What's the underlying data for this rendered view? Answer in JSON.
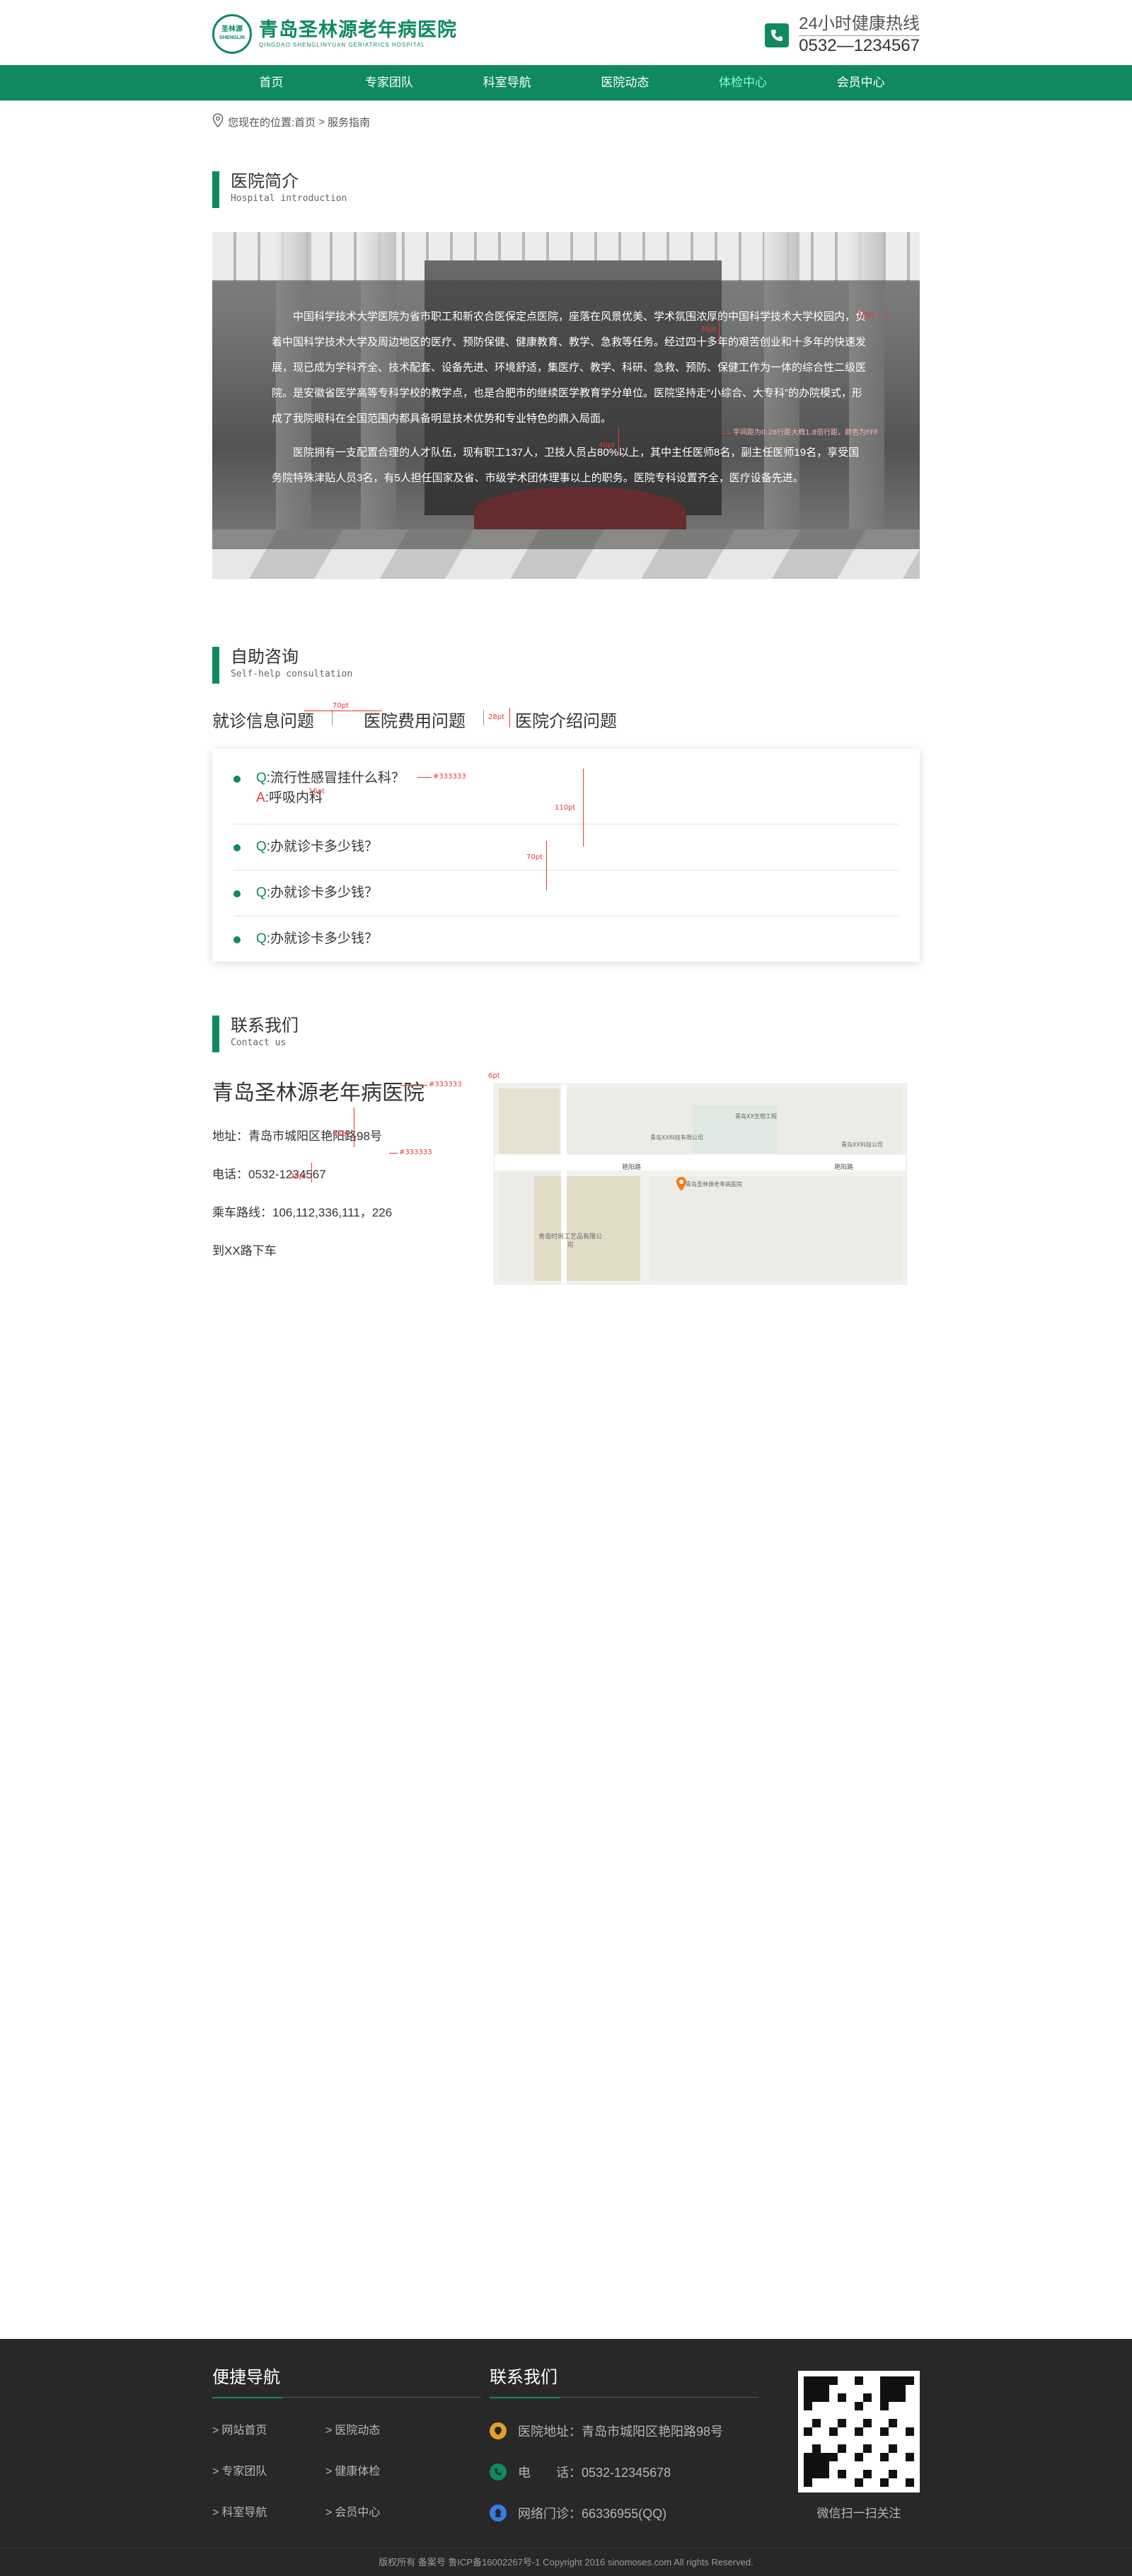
{
  "header": {
    "logo_mark_line1": "圣林源",
    "logo_mark_line2": "SHENGLIN",
    "logo_cn": "青岛圣林源老年病医院",
    "logo_en": "QINGDAO SHENGLINYUAN GERIATRICS HOSPITAL",
    "hotline_title": "24小时健康热线",
    "hotline_number": "0532—1234567"
  },
  "nav": {
    "items": [
      "首页",
      "专家团队",
      "科室导航",
      "医院动态",
      "体检中心",
      "会员中心"
    ],
    "active_index": 4
  },
  "breadcrumb": {
    "prefix": "您现在的位置:",
    "home": "首页",
    "separator": ">",
    "current": "服务指南"
  },
  "intro": {
    "title_cn": "医院简介",
    "title_en": "Hospital introduction",
    "paragraph1": "中国科学技术大学医院为省市职工和新农合医保定点医院，座落在风景优美、学术氛围浓厚的中国科学技术大学校园内，负着中国科学技术大学及周边地区的医疗、预防保健、健康教育、教学、急救等任务。经过四十多年的艰苦创业和十多年的快速发展，现已成为学科齐全、技术配套、设备先进、环境舒适，集医疗、教学、科研、急救、预防、保健工作为一体的综合性二级医院。是安徽省医学高等专科学校的教学点，也是合肥市的继续医学教育学分单位。医院坚持走“小综合、大专科”的办院模式，形成了我院眼科在全国范围内都具备明显技术优势和专业特色的鼎入局面。",
    "paragraph2": "医院拥有一支配置合理的人才队伍，现有职工137人，卫技人员占80%以上，其中主任医师8名，副主任医师19名，享受国务院特殊津贴人员3名，有5人担任国家及省、市级学术团体理事以上的职务。医院专科设置齐全，医疗设备先进。"
  },
  "consult": {
    "title_cn": "自助咨询",
    "title_en": "Self-help consultation",
    "tabs": [
      "就诊信息问题",
      "医院费用问题",
      "医院介绍问题"
    ],
    "faqs": [
      {
        "q_mark": "Q",
        "question": ":流行性感冒挂什么科？",
        "a_mark": "A",
        "answer": ":呼吸内科"
      },
      {
        "q_mark": "Q",
        "question": ":办就诊卡多少钱？"
      },
      {
        "q_mark": "Q",
        "question": ":办就诊卡多少钱？"
      },
      {
        "q_mark": "Q",
        "question": ":办就诊卡多少钱？"
      }
    ]
  },
  "contact": {
    "title_cn": "联系我们",
    "title_en": "Contact us",
    "hospital_name": "青岛圣林源老年病医院",
    "address": "地址：青岛市城阳区艳阳路98号",
    "phone": "电话：0532-1234567",
    "bus": "乘车路线：106,112,336,111，226",
    "bus2": "到XX路下车",
    "map_labels": {
      "road1": "艳阳路",
      "road2": "艳阳路",
      "poi_main": "青岛圣林源老年病医院",
      "poi_factory": "青岛时尚工艺品有限公司",
      "poi_a": "青岛XX科技有限公司",
      "poi_b": "青岛XX生物工程",
      "poi_c": "青岛XX科技公司"
    }
  },
  "annotations": {
    "a1": "16pt",
    "a2": "36pt",
    "a3": "字间距为0.28行距大概1.8倍行距，颜色为FFF",
    "a4": "40pt",
    "a5": "70pt",
    "a6": "28pt",
    "a7": "#333333",
    "a8": "16pt",
    "a9": "110pt",
    "a10": "70pt",
    "a11": "6pt",
    "a12": "#333333",
    "a13": "56pt",
    "a14": "#333333",
    "a15": "28pt"
  },
  "footer": {
    "nav_title": "便捷导航",
    "nav_links": [
      "网站首页",
      "医院动态",
      "专家团队",
      "健康体检",
      "科室导航",
      "会员中心"
    ],
    "link_prefix": ">",
    "contact_title": "联系我们",
    "address": "医院地址：青岛市城阳区艳阳路98号",
    "phone": "电　　话：0532-12345678",
    "online": "网络门诊：66336955(QQ)",
    "qr_caption": "微信扫一扫关注",
    "copyright": "版权所有 备案号 鲁ICP备16002267号-1 Copyright 2016 sinomoses.com All rights Reserved."
  },
  "colors": {
    "brand_green": "#0f8a5f",
    "nav_active": "#7dffd6",
    "annotation_red": "#e4393c",
    "footer_bg": "#282828",
    "loc_orange": "#e0a12a",
    "qq_blue": "#3a7be0"
  }
}
